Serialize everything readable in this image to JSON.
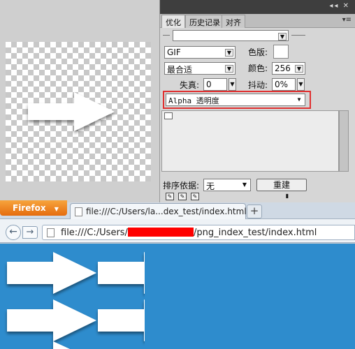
{
  "panel": {
    "window_controls": "◂◂ ✕",
    "tabs": [
      "优化",
      "历史记录",
      "对齐"
    ],
    "tab_menu": "▾≡",
    "preset_value": "",
    "format_value": "GIF",
    "palette_label": "色版:",
    "method_value": "最合适",
    "colors_label": "颜色:",
    "colors_value": "256",
    "lossy_label": "失真:",
    "lossy_value": "0",
    "dither_label": "抖动:",
    "dither_value": "0%",
    "transparency_value": "Alpha 透明度",
    "sort_label": "排序依据:",
    "sort_value": "无",
    "rebuild_label": "重建"
  },
  "browser": {
    "app_button": "Firefox",
    "tab_title": "file:///C:/Users/la...dex_test/index.html",
    "new_tab": "+",
    "back": "←",
    "forward": "→",
    "url_start": "file:///C:/Users/",
    "url_end": "/png_index_test/index.html"
  },
  "colors": {
    "page_bg": "#2e8ccd",
    "firefox_orange": "#e9781a",
    "redaction": "#ff0000"
  }
}
